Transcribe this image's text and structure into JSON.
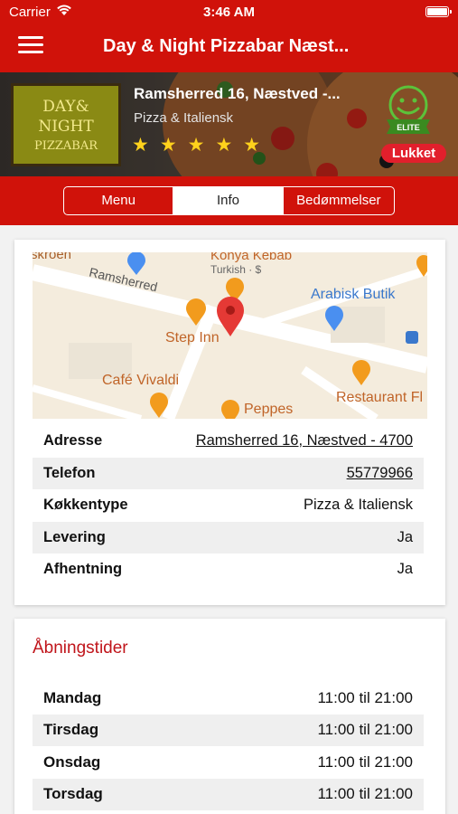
{
  "status_bar": {
    "carrier": "Carrier",
    "time": "3:46 AM"
  },
  "nav": {
    "title": "Day & Night Pizzabar Næst..."
  },
  "restaurant": {
    "logo_lines": [
      "DAY&",
      "NIGHT",
      "PIZZABAR"
    ],
    "name": "Ramsherred 16, Næstved -...",
    "cuisine": "Pizza & Italiensk",
    "stars": "★★★★★",
    "rating": 5,
    "badge_text": "ELITE",
    "status": "Lukket"
  },
  "tabs": [
    {
      "label": "Menu",
      "active": false
    },
    {
      "label": "Info",
      "active": true
    },
    {
      "label": "Bedømmelser",
      "active": false
    }
  ],
  "map": {
    "labels": {
      "top_left": "skroen",
      "konya": "Konya Kebab",
      "konya_sub": "Turkish · $",
      "street": "Ramsherred",
      "arabisk": "Arabisk Butik",
      "step_inn": "Step Inn",
      "cafe": "Café Vivaldi",
      "restaurant": "Restaurant Fl",
      "peppes": "Peppes"
    }
  },
  "info": [
    {
      "key": "Adresse",
      "value": "Ramsherred 16, Næstved - 4700",
      "link": true
    },
    {
      "key": "Telefon",
      "value": "55779966",
      "link": true
    },
    {
      "key": "Køkkentype",
      "value": "Pizza & Italiensk",
      "link": false
    },
    {
      "key": "Levering",
      "value": "Ja",
      "link": false
    },
    {
      "key": "Afhentning",
      "value": "Ja",
      "link": false
    }
  ],
  "hours_title": "Åbningstider",
  "hours": [
    {
      "day": "Mandag",
      "time": "11:00 til 21:00"
    },
    {
      "day": "Tirsdag",
      "time": "11:00 til 21:00"
    },
    {
      "day": "Onsdag",
      "time": "11:00 til 21:00"
    },
    {
      "day": "Torsdag",
      "time": "11:00 til 21:00"
    }
  ],
  "colors": {
    "brand_red": "#d0120a",
    "status_red": "#e21f2c",
    "section_red": "#c0151b",
    "star": "#ffd21c"
  }
}
